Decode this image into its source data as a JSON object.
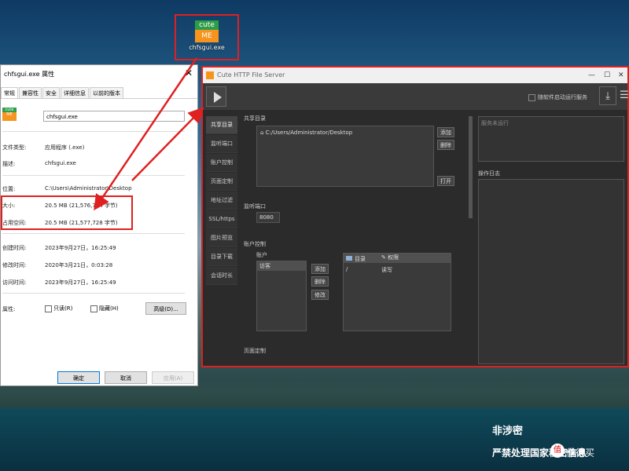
{
  "desktop": {
    "icon_top": "cute",
    "icon_bottom": "ME",
    "icon_label": "chfsgui.exe"
  },
  "props": {
    "title": "chfsgui.exe 属性",
    "tabs": [
      "常规",
      "兼容性",
      "安全",
      "详细信息",
      "以前的版本"
    ],
    "filename": "chfsgui.exe",
    "rows": [
      {
        "label": "文件类型:",
        "value": "应用程序 (.exe)"
      },
      {
        "label": "描述:",
        "value": "chfsgui.exe"
      },
      {
        "label": "位置:",
        "value": "C:\\Users\\Administrator\\Desktop"
      },
      {
        "label": "大小:",
        "value": "20.5 MB (21,576,704 字节)"
      },
      {
        "label": "占用空间:",
        "value": "20.5 MB (21,577,728 字节)"
      },
      {
        "label": "创建时间:",
        "value": "2023年9月27日，16:25:49"
      },
      {
        "label": "修改时间:",
        "value": "2020年3月21日，0:03:28"
      },
      {
        "label": "访问时间:",
        "value": "2023年9月27日，16:25:49"
      }
    ],
    "attr_label": "属性:",
    "readonly": "只读(R)",
    "hidden": "隐藏(H)",
    "advanced": "高级(D)...",
    "ok": "确定",
    "cancel": "取消",
    "apply": "应用(A)"
  },
  "server": {
    "title": "Cute HTTP File Server",
    "autostart": "随软件启动运行服务",
    "sidebar": [
      "共享目录",
      "监听端口",
      "账户控制",
      "页面定制",
      "地址过滤",
      "SSL/https",
      "图片预览",
      "目录下载",
      "会话时长"
    ],
    "shared_dir_label": "共享目录",
    "shared_path": "C:/Users/Administrator/Desktop",
    "add": "添加",
    "delete": "删除",
    "open": "打开",
    "port_label": "监听端口",
    "port_value": "8080",
    "account_label": "账户控制",
    "accounts_label": "账户",
    "account_item": "访客",
    "edit": "修改",
    "col_dir": "目录",
    "col_perm": "权限",
    "perm_dir": "/",
    "perm_value": "读写",
    "page_label": "页面定制",
    "status_text": "服务未运行",
    "log_label": "操作日志"
  },
  "watermark": {
    "line1": "非涉密",
    "line2": "严禁处理国家秘密信息",
    "brand": "值得买"
  }
}
